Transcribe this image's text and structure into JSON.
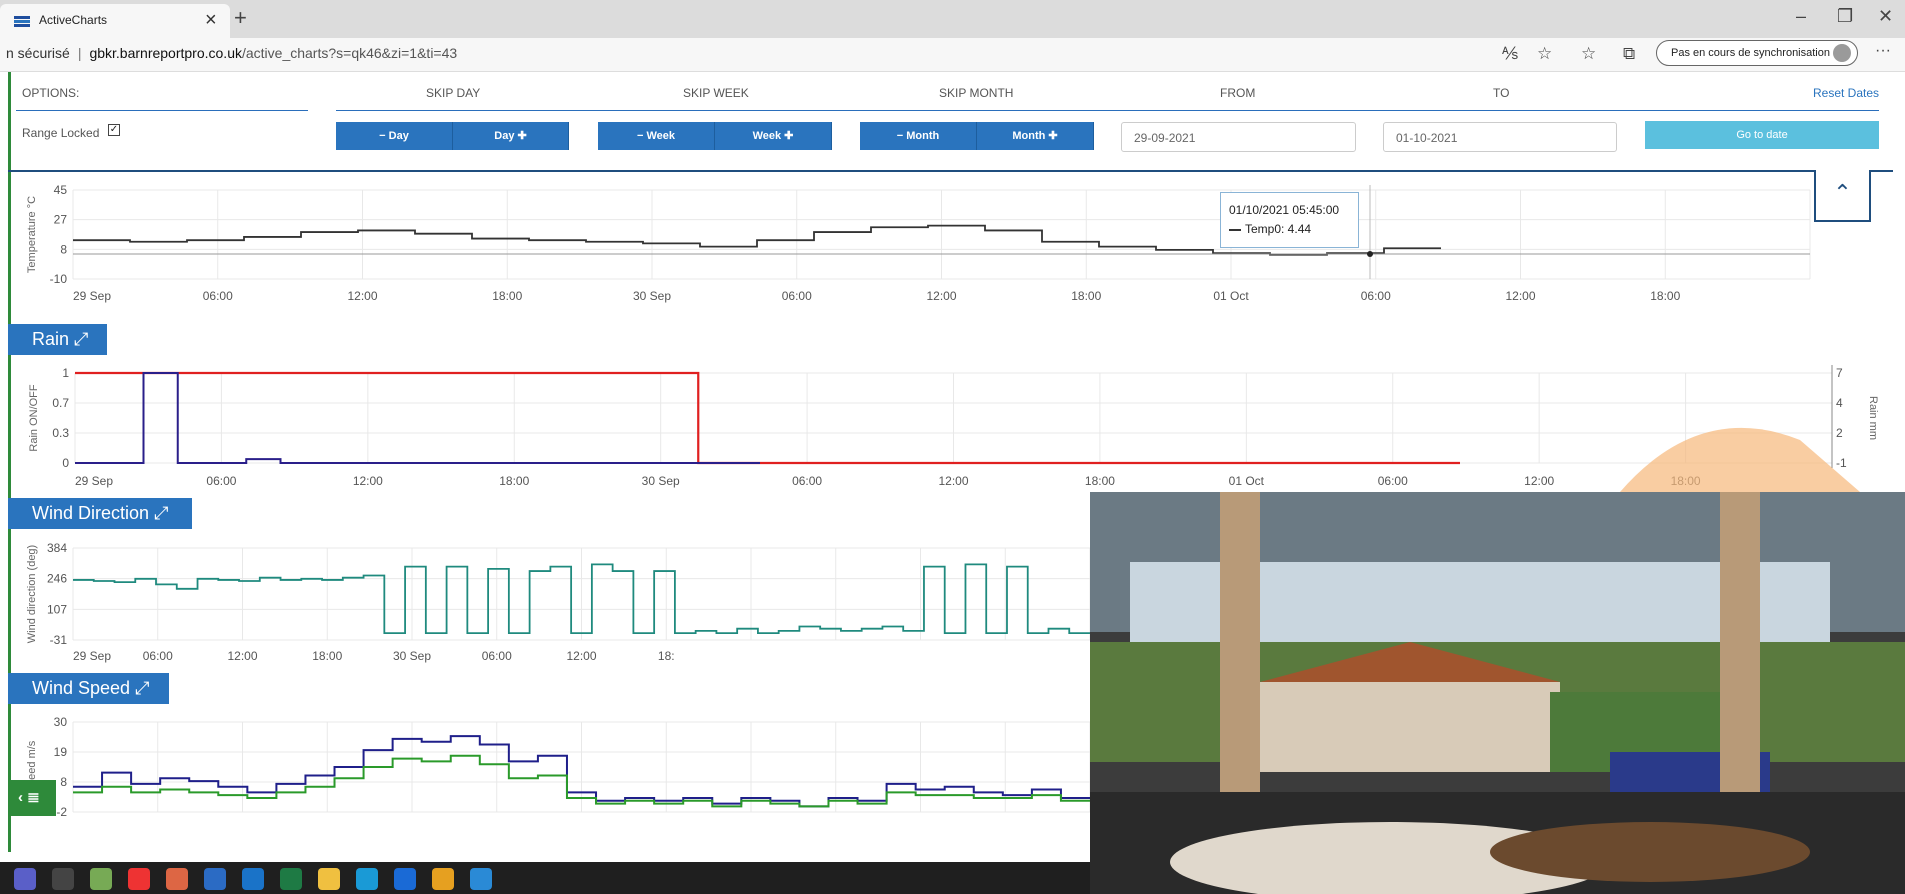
{
  "browser": {
    "tab_title": "ActiveCharts",
    "tab_close": "×",
    "new_tab": "+",
    "address_security": "n sécurisé",
    "address_separator": "|",
    "address_domain": "gbkr.barnreportpro.co.uk",
    "address_path": "/active_charts?s=qk46&zi=1&ti=43",
    "sync_label": "Pas en cours de synchronisation",
    "more_label": "···",
    "minimize": "–",
    "restore": "❐",
    "close": "✕"
  },
  "options": {
    "options_label": "OPTIONS:",
    "skip_day": "SKIP DAY",
    "skip_week": "SKIP WEEK",
    "skip_month": "SKIP MONTH",
    "from": "FROM",
    "to": "TO",
    "reset_dates": "Reset Dates",
    "range_locked": "Range Locked",
    "range_locked_checked": true,
    "day_minus": "− Day",
    "day_plus": "Day ✚",
    "week_minus": "− Week",
    "week_plus": "Week ✚",
    "month_minus": "− Month",
    "month_plus": "Month ✚",
    "from_value": "29-09-2021",
    "to_value": "01-10-2021",
    "go_to_date": "Go to date"
  },
  "panels": {
    "rain_title": "Rain",
    "wind_dir_title": "Wind Direction",
    "wind_speed_title": "Wind Speed"
  },
  "tooltip": {
    "time": "01/10/2021 05:45:00",
    "series": "Temp0: 4.44"
  },
  "colors": {
    "accent": "#2a74be",
    "temp_line": "#333333",
    "rain_onoff": "#e02020",
    "rain_mm": "#2a1f8a",
    "wind_dir": "#1f8a7e",
    "wind_speed_a": "#1f1f8a",
    "wind_speed_b": "#2a9a2a",
    "sidebar": "#2e8a3a"
  },
  "chart_data": [
    {
      "type": "line",
      "name": "temperature",
      "ylabel": "Temperature °C",
      "yticks": [
        45,
        27,
        8,
        -10
      ],
      "ylim": [
        -10,
        45
      ],
      "xticks": [
        "29 Sep",
        "06:00",
        "12:00",
        "18:00",
        "30 Sep",
        "06:00",
        "12:00",
        "18:00",
        "01 Oct",
        "06:00",
        "12:00",
        "18:00"
      ],
      "series": [
        {
          "name": "Temp0",
          "values": [
            14,
            13,
            14,
            16,
            19,
            20,
            18,
            15,
            14,
            13,
            12,
            10,
            14,
            19,
            22,
            23,
            20,
            13,
            10,
            8,
            6,
            5,
            6,
            9
          ]
        }
      ]
    },
    {
      "type": "line",
      "name": "rain",
      "ylabel": "Rain ON/OFF",
      "y2label": "Rain mm",
      "yticks": [
        1.0,
        0.7,
        0.3,
        0.0
      ],
      "y2ticks": [
        7,
        4,
        2,
        -1
      ],
      "xticks": [
        "29 Sep",
        "06:00",
        "12:00",
        "18:00",
        "30 Sep",
        "06:00",
        "12:00",
        "18:00",
        "01 Oct",
        "06:00",
        "12:00",
        "18:00"
      ],
      "series": [
        {
          "values": [
            1,
            1,
            1,
            1,
            1,
            1,
            1,
            1,
            1,
            0,
            0,
            0,
            0,
            0,
            0,
            0,
            0,
            0,
            0,
            0
          ]
        },
        {
          "values": [
            0,
            0,
            7,
            0,
            0,
            0.3,
            0,
            0,
            0,
            0,
            0,
            0,
            0,
            0,
            0,
            0,
            0,
            0,
            0,
            0
          ]
        }
      ]
    },
    {
      "type": "line",
      "name": "wind_direction",
      "ylabel": "Wind direction (deg)",
      "yticks": [
        384,
        246,
        107,
        -31
      ],
      "xticks": [
        "29 Sep",
        "06:00",
        "12:00",
        "18:00",
        "30 Sep",
        "06:00",
        "12:00",
        "18:"
      ],
      "series": [
        {
          "values": [
            240,
            235,
            230,
            245,
            220,
            200,
            245,
            240,
            235,
            250,
            240,
            245,
            240,
            250,
            260,
            0,
            300,
            0,
            300,
            0,
            290,
            0,
            280,
            300,
            0,
            310,
            280,
            0,
            280,
            0,
            10,
            0,
            20,
            0,
            10,
            30,
            20,
            10,
            20,
            30,
            10,
            300,
            0,
            310,
            0,
            300,
            0,
            20,
            0
          ]
        }
      ]
    },
    {
      "type": "line",
      "name": "wind_speed",
      "ylabel": "Speed m/s",
      "yticks": [
        30,
        19,
        8,
        -2
      ],
      "series": [
        {
          "values": [
            7,
            12,
            8,
            10,
            9,
            7,
            5,
            8,
            11,
            14,
            20,
            24,
            23,
            25,
            22,
            16,
            18,
            5,
            2,
            3,
            2,
            3,
            1,
            3,
            2,
            0,
            3,
            2,
            8,
            6,
            7,
            5,
            4,
            6,
            3
          ]
        },
        {
          "values": [
            5,
            7,
            5,
            6,
            5,
            4,
            3,
            5,
            7,
            10,
            14,
            17,
            16,
            18,
            15,
            10,
            11,
            3,
            1,
            2,
            1,
            2,
            0,
            2,
            1,
            0,
            2,
            1,
            5,
            4,
            4,
            3,
            3,
            4,
            2
          ]
        }
      ]
    }
  ],
  "taskbar": {
    "icons": [
      "teams-icon",
      "calculator-icon",
      "paint-icon",
      "chrome-icon",
      "powerpoint-icon",
      "word-icon",
      "outlook-icon",
      "excel-icon",
      "file-explorer-icon",
      "edge-icon",
      "internet-explorer-icon",
      "chrome-canary-icon",
      "photos-icon"
    ]
  },
  "sidebar_button": "‹ ≣"
}
